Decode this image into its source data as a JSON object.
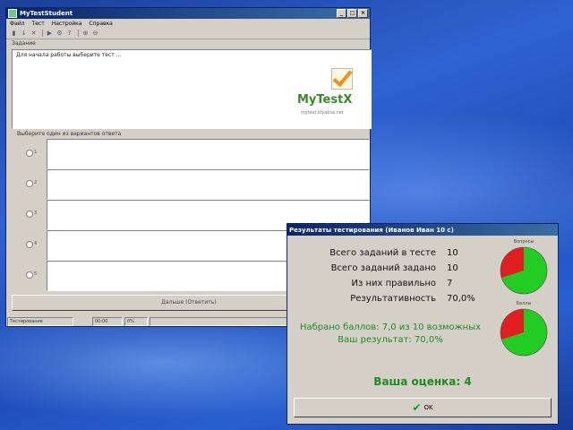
{
  "app": {
    "title": "MyTestStudent",
    "window_buttons": [
      "_",
      "□",
      "×"
    ],
    "menu": [
      "Файл",
      "Тест",
      "Настройка",
      "Справка"
    ],
    "toolbar_icons": [
      "run-icon",
      "down-icon",
      "stop-icon",
      "play-icon",
      "settings-icon",
      "help-icon",
      "zoom-in-icon",
      "zoom-out-icon"
    ],
    "question_label": "Задание",
    "question_text": "Для начала работы выберите тест ...",
    "logo": {
      "text": "MyTestX",
      "site": "mytest.klyaksa.net"
    },
    "answers_label": "Выберите один из вариантов ответа",
    "answers": [
      {
        "label": "1"
      },
      {
        "label": "2"
      },
      {
        "label": "3"
      },
      {
        "label": "4"
      },
      {
        "label": "5"
      }
    ],
    "next_button": "Дальше (Ответить)",
    "status": [
      "Тестирование",
      "00:00",
      "0%",
      ""
    ]
  },
  "result": {
    "title": "Результаты тестирования (Иванов Иван 10 с)",
    "stats": [
      {
        "label": "Всего заданий в тесте",
        "value": "10"
      },
      {
        "label": "Всего заданий задано",
        "value": "10"
      },
      {
        "label": "Из них правильно",
        "value": "7"
      },
      {
        "label": "Результативность",
        "value": "70,0%"
      }
    ],
    "score_lines": [
      "Набрано баллов: 7,0 из 10 возможных",
      "Ваш результат: 70,0%"
    ],
    "pies": [
      {
        "title": "Вопросы",
        "fraction_correct": 0.7,
        "colors": {
          "correct": "#22cc22",
          "wrong": "#e02020"
        }
      },
      {
        "title": "Баллы",
        "fraction_correct": 0.7,
        "colors": {
          "correct": "#22cc22",
          "wrong": "#e02020"
        }
      }
    ],
    "grade": "Ваша оценка: 4",
    "ok_button": "OK"
  }
}
